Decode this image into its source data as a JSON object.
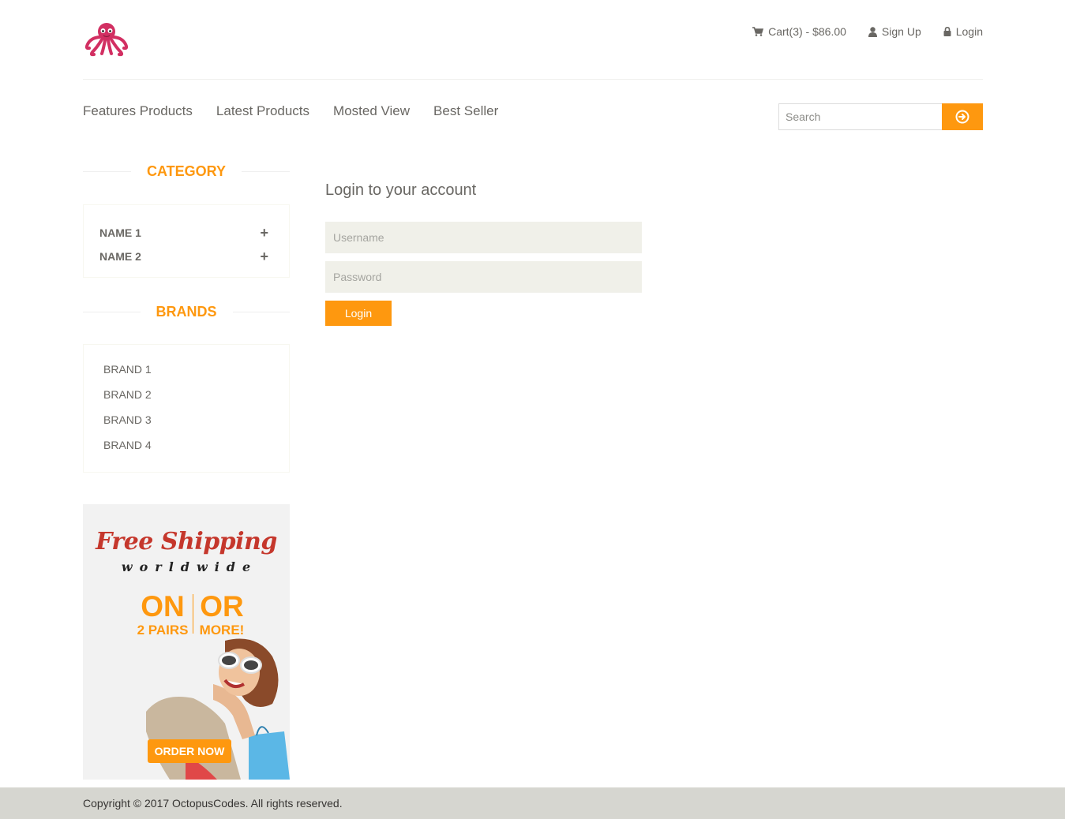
{
  "header": {
    "logo": "octopus-logo",
    "cart_label": "Cart(3) - $86.00",
    "signup_label": "Sign Up",
    "login_label": "Login"
  },
  "nav": {
    "items": [
      "Features Products",
      "Latest Products",
      "Mosted View",
      "Best Seller"
    ]
  },
  "search": {
    "placeholder": "Search",
    "button_icon": "arrow-circle-right-icon"
  },
  "sidebar": {
    "category_title": "CATEGORY",
    "categories": [
      {
        "label": "NAME 1",
        "icon": "plus-icon"
      },
      {
        "label": "NAME 2",
        "icon": "plus-icon"
      }
    ],
    "brands_title": "BRANDS",
    "brands": [
      "BRAND 1",
      "BRAND 2",
      "BRAND 3",
      "BRAND 4"
    ]
  },
  "ad": {
    "headline": "Free Shipping",
    "subline": "worldwide",
    "left_big": "ON",
    "left_small": "2 PAIRS",
    "right_big": "OR",
    "right_small": "MORE!",
    "button": "ORDER NOW"
  },
  "login": {
    "title": "Login to your account",
    "username_placeholder": "Username",
    "password_placeholder": "Password",
    "button": "Login"
  },
  "footer": {
    "text": "Copyright © 2017 OctopusCodes. All rights reserved."
  },
  "colors": {
    "accent": "#fe980f",
    "text": "#696763",
    "field_bg": "#f0f0e9",
    "footer_bg": "#d6d6d0"
  }
}
